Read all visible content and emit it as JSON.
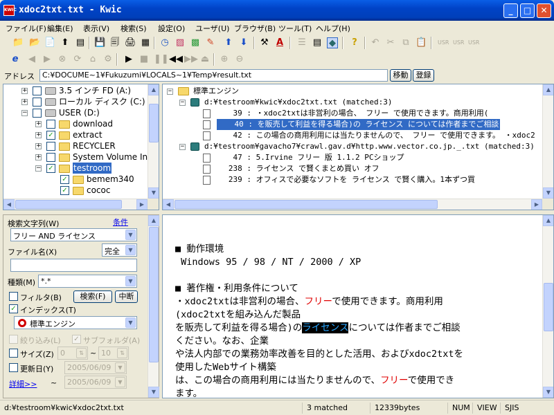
{
  "window": {
    "title": "xdoc2txt.txt - Kwic",
    "app_icon": "kwic-app-icon"
  },
  "menu": [
    "ファイル(F)",
    "編集(E)",
    "表示(V)",
    "検索(S)",
    "設定(O)",
    "ユーザ(U)",
    "ブラウザ(B)",
    "ツール(T)",
    "ヘルプ(H)"
  ],
  "address": {
    "label": "アドレス",
    "value": "C:¥DOCUME~1¥Fukuzumi¥LOCALS~1¥Temp¥result.txt",
    "move_label": "移動",
    "register_label": "登録"
  },
  "folder_tree": {
    "items": [
      {
        "label": "3.5 インチ FD (A:)",
        "checked": false
      },
      {
        "label": "ローカル ディスク (C:)",
        "checked": false
      },
      {
        "label": "USER (D:)",
        "checked": false
      },
      {
        "label": "download",
        "checked": false
      },
      {
        "label": "extract",
        "checked": true
      },
      {
        "label": "RECYCLER",
        "checked": false
      },
      {
        "label": "System Volume Information",
        "checked": false
      },
      {
        "label": "testroom",
        "checked": true,
        "selected": true
      },
      {
        "label": "bemem340",
        "checked": true
      },
      {
        "label": "cococ",
        "checked": true
      }
    ]
  },
  "results": {
    "root": "標準エンジン",
    "file1": {
      "path": "d:¥testroom¥kwic¥xdoc2txt.txt (matched:3)",
      "lines": [
        {
          "num": "39 :",
          "text": "        ・xdoc2txtは非営利の場合、 フリー で使用できます。商用利用("
        },
        {
          "num": "40 :",
          "text": "  を販売して利益を得る場合)の ライセンス については作者までご相談",
          "selected": true
        },
        {
          "num": "42 :",
          "text": "この場合の商用利用には当たりませんので、 フリー で使用できます。  ・xdoc2"
        }
      ]
    },
    "file2": {
      "path": "d:¥testroom¥gavacho7¥crawl.gav.d¥http.www.vector.co.jp._.txt (matched:3)",
      "lines": [
        {
          "num": "47 :",
          "text": "            5.Irvine フリー 版 1.1.2      PCショップ"
        },
        {
          "num": "238 :",
          "text": "              ライセンス で賢くまとめ買い  オフ"
        },
        {
          "num": "239 :",
          "text": "      オフィスで必要なソフトを ライセンス で賢く購入。1本ずつ買"
        }
      ]
    }
  },
  "search": {
    "keyword_label": "検索文字列(W)",
    "condition_link": "条件",
    "keyword_value": "フリー AND ライセンス",
    "filename_label": "ファイル名(X)",
    "match_mode": "完全",
    "filename_value": "",
    "type_label": "種類(M)",
    "type_value": "*.*",
    "filter_label": "フィルタ(B)",
    "index_label": "インデックス(T)",
    "index_checked": true,
    "search_button": "検索(F)",
    "stop_button": "中断",
    "engine_value": "標準エンジン",
    "narrow_label": "絞り込み(L)",
    "subfolder_label": "サブフォルダ(A)",
    "size_label": "サイズ(Z)",
    "size_from": "0",
    "size_to": "10",
    "tilde": "~",
    "date_label": "更新日(Y)",
    "date_from": "2005/06/09",
    "date_to": "2005/06/09",
    "details_link": "詳細>>"
  },
  "viewer": {
    "heading1": "■ 動作環境",
    "os": " Windows 95 / 98 / NT / 2000 / XP",
    "heading2": "■ 著作権・利用条件について",
    "p1a": "・xdoc2txtは非営利の場合、",
    "p1_free": "フリー",
    "p1b": "で使用できます。商用利用",
    "p2": "(xdoc2txtを組み込んだ製品",
    "p3a": "を販売して利益を得る場合)の",
    "p3_license": "ライセンス",
    "p3b": "については作者までご相談",
    "p4": "ください。なお、企業",
    "p5": "や法人内部での業務効率改善を目的とした活用、およびxdoc2txtを",
    "p6": "使用したWebサイト構築",
    "p7a": "は、この場合の商用利用には当たりませんので、",
    "p7_free": "フリー",
    "p7b": "で使用でき",
    "p8": "ます。"
  },
  "status": {
    "path": "d:¥testroom¥kwic¥xdoc2txt.txt",
    "matched": "3 matched",
    "bytes": "12339bytes",
    "num": "NUM",
    "view": "VIEW",
    "enc": "SJIS"
  }
}
